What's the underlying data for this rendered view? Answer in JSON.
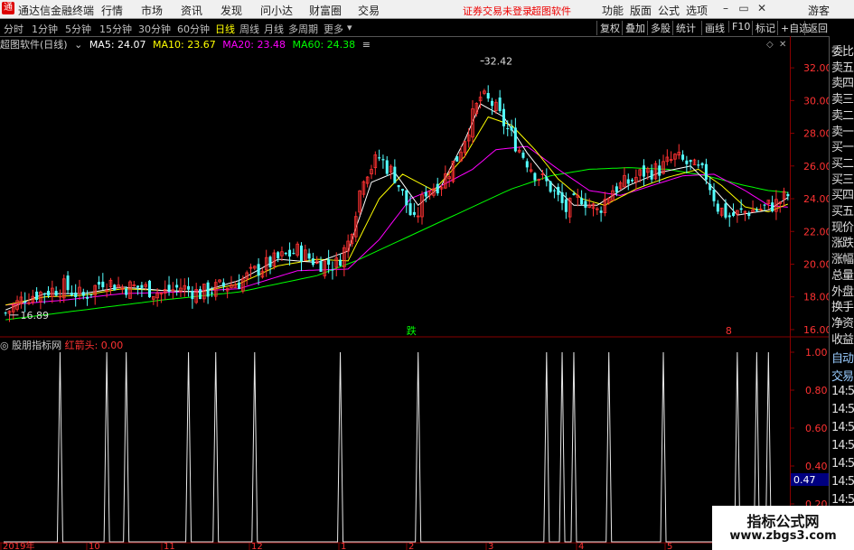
{
  "titlebar": {
    "app_title": "通达信金融终端",
    "menu": [
      "行情",
      "市场",
      "资讯",
      "发现",
      "问小达",
      "财富圈",
      "交易"
    ],
    "notice_unlogged": "证券交易未登录",
    "notice_software": "超图软件",
    "right_menu": [
      "功能",
      "版面",
      "公式",
      "选项"
    ],
    "guest": "游客",
    "min_icon": "minimize-icon",
    "max_icon": "maximize-icon",
    "close_icon": "close-icon"
  },
  "periods": [
    "分时",
    "1分钟",
    "5分钟",
    "15分钟",
    "30分钟",
    "60分钟",
    "日线",
    "周线",
    "月线",
    "多周期",
    "更多"
  ],
  "active_period": "日线",
  "toolbar_right": [
    "复权",
    "叠加",
    "多股",
    "统计",
    "画线",
    "F10",
    "标记",
    "+自选",
    "返回"
  ],
  "main_info": {
    "stock": "超图软件(日线)",
    "ma5": "MA5: 24.07",
    "ma10": "MA10: 23.67",
    "ma20": "MA20: 23.48",
    "ma60": "MA60: 24.38",
    "colors": {
      "ma5": "#ffffff",
      "ma10": "#ffff00",
      "ma20": "#ff00ff",
      "ma60": "#00ff00"
    }
  },
  "indicator_info": {
    "name": "股朋指标网",
    "value": "红箭头: 0.00"
  },
  "annotations": {
    "high": "32.42",
    "low": "16.89",
    "marker_die": "跌",
    "marker_8": "8"
  },
  "x_axis_labels": [
    "2019年",
    "10",
    "11",
    "12",
    "1",
    "2",
    "3",
    "4",
    "5"
  ],
  "right_panel_top": [
    "委比",
    "卖五",
    "卖四",
    "卖三",
    "卖二",
    "卖一",
    "买一",
    "买二",
    "买三",
    "买四",
    "买五",
    "现价",
    "涨跌",
    "涨幅",
    "总量",
    "外盘",
    "换手",
    "净资",
    "收益"
  ],
  "right_panel_bottom": [
    "自动",
    "交易",
    "14:5",
    "14:5",
    "14:5",
    "14:5",
    "14:5",
    "14:5",
    "14:5",
    "14:5"
  ],
  "cursor_value": "0.47",
  "watermark": {
    "line1": "指标公式网",
    "line2": "www.zbgs3.com"
  },
  "chart_data": [
    {
      "type": "candlestick",
      "title": "超图软件(日线)",
      "ylim": [
        15.5,
        33.0
      ],
      "y_ticks": [
        16.0,
        18.0,
        20.0,
        22.0,
        24.0,
        26.0,
        28.0,
        30.0,
        32.0
      ],
      "up_color": "#ff3232",
      "down_color": "#54ffff",
      "close_trend": [
        [
          0,
          17.0
        ],
        [
          5,
          18.0
        ],
        [
          10,
          18.3
        ],
        [
          15,
          18.6
        ],
        [
          20,
          18.0
        ],
        [
          25,
          19.0
        ],
        [
          30,
          18.6
        ],
        [
          35,
          18.6
        ],
        [
          40,
          18.2
        ],
        [
          45,
          18.6
        ],
        [
          50,
          18.2
        ],
        [
          55,
          18.6
        ],
        [
          60,
          18.9
        ],
        [
          65,
          19.7
        ],
        [
          70,
          20.3
        ],
        [
          75,
          20.8
        ],
        [
          80,
          20.1
        ],
        [
          85,
          20.0
        ],
        [
          88,
          21.3
        ],
        [
          92,
          25.5
        ],
        [
          96,
          26.5
        ],
        [
          100,
          25.4
        ],
        [
          105,
          22.5
        ],
        [
          108,
          24.5
        ],
        [
          112,
          25.0
        ],
        [
          116,
          26.5
        ],
        [
          119,
          28.4
        ],
        [
          122,
          30.2
        ],
        [
          125,
          29.8
        ],
        [
          128,
          28.6
        ],
        [
          132,
          27.0
        ],
        [
          136,
          25.6
        ],
        [
          140,
          24.7
        ],
        [
          144,
          23.3
        ],
        [
          148,
          24.1
        ],
        [
          152,
          23.2
        ],
        [
          156,
          24.6
        ],
        [
          160,
          25.0
        ],
        [
          164,
          25.6
        ],
        [
          168,
          25.8
        ],
        [
          172,
          26.5
        ],
        [
          176,
          26.0
        ],
        [
          180,
          25.4
        ],
        [
          183,
          23.5
        ],
        [
          186,
          22.9
        ],
        [
          190,
          23.2
        ],
        [
          194,
          23.4
        ],
        [
          198,
          23.7
        ],
        [
          201,
          24.2
        ]
      ],
      "ma5_trend": [
        [
          0,
          17.2
        ],
        [
          10,
          18.2
        ],
        [
          20,
          18.2
        ],
        [
          30,
          18.6
        ],
        [
          40,
          18.4
        ],
        [
          50,
          18.3
        ],
        [
          60,
          19.0
        ],
        [
          70,
          20.3
        ],
        [
          80,
          20.1
        ],
        [
          88,
          20.8
        ],
        [
          94,
          25.0
        ],
        [
          100,
          25.6
        ],
        [
          106,
          23.6
        ],
        [
          112,
          24.8
        ],
        [
          118,
          27.6
        ],
        [
          122,
          29.8
        ],
        [
          128,
          29.0
        ],
        [
          134,
          26.8
        ],
        [
          140,
          25.0
        ],
        [
          146,
          23.6
        ],
        [
          152,
          23.6
        ],
        [
          160,
          24.8
        ],
        [
          168,
          25.6
        ],
        [
          176,
          26.0
        ],
        [
          182,
          24.6
        ],
        [
          188,
          23.0
        ],
        [
          196,
          23.3
        ],
        [
          201,
          24.07
        ]
      ],
      "ma10_trend": [
        [
          0,
          17.5
        ],
        [
          10,
          18.0
        ],
        [
          20,
          18.1
        ],
        [
          30,
          18.5
        ],
        [
          40,
          18.4
        ],
        [
          50,
          18.3
        ],
        [
          60,
          18.8
        ],
        [
          70,
          19.9
        ],
        [
          80,
          20.3
        ],
        [
          88,
          20.2
        ],
        [
          96,
          24.0
        ],
        [
          102,
          25.5
        ],
        [
          110,
          24.5
        ],
        [
          118,
          26.6
        ],
        [
          124,
          29.0
        ],
        [
          130,
          28.5
        ],
        [
          136,
          27.0
        ],
        [
          142,
          25.2
        ],
        [
          148,
          24.0
        ],
        [
          154,
          23.6
        ],
        [
          162,
          24.6
        ],
        [
          170,
          25.3
        ],
        [
          178,
          25.8
        ],
        [
          184,
          24.8
        ],
        [
          190,
          23.5
        ],
        [
          196,
          23.2
        ],
        [
          201,
          23.67
        ]
      ],
      "ma20_trend": [
        [
          0,
          17.5
        ],
        [
          15,
          17.8
        ],
        [
          30,
          18.2
        ],
        [
          45,
          18.3
        ],
        [
          60,
          18.5
        ],
        [
          75,
          19.6
        ],
        [
          88,
          19.7
        ],
        [
          96,
          21.5
        ],
        [
          104,
          24.0
        ],
        [
          112,
          24.8
        ],
        [
          120,
          25.8
        ],
        [
          126,
          27.0
        ],
        [
          134,
          27.2
        ],
        [
          142,
          25.8
        ],
        [
          150,
          24.5
        ],
        [
          158,
          24.2
        ],
        [
          166,
          24.8
        ],
        [
          174,
          25.4
        ],
        [
          182,
          25.5
        ],
        [
          190,
          24.5
        ],
        [
          196,
          23.6
        ],
        [
          201,
          23.48
        ]
      ],
      "ma60_trend": [
        [
          0,
          16.6
        ],
        [
          20,
          17.2
        ],
        [
          40,
          17.8
        ],
        [
          60,
          18.3
        ],
        [
          80,
          19.3
        ],
        [
          90,
          20.2
        ],
        [
          100,
          21.3
        ],
        [
          110,
          22.4
        ],
        [
          120,
          23.5
        ],
        [
          130,
          24.6
        ],
        [
          140,
          25.4
        ],
        [
          150,
          25.8
        ],
        [
          160,
          25.9
        ],
        [
          170,
          25.8
        ],
        [
          180,
          25.4
        ],
        [
          190,
          24.8
        ],
        [
          196,
          24.5
        ],
        [
          201,
          24.38
        ]
      ]
    },
    {
      "type": "line",
      "title": "股朋指标网",
      "ylim": [
        0.0,
        1.0
      ],
      "y_ticks": [
        0.2,
        0.4,
        0.6,
        0.8,
        1.0
      ],
      "series": [
        {
          "name": "红箭头",
          "value": 0.0,
          "spike_positions": [
            14,
            26,
            31,
            47,
            54,
            64,
            86,
            106,
            139,
            143,
            146,
            155,
            169,
            188,
            193,
            196
          ],
          "spike_value": 1.0
        }
      ]
    }
  ]
}
